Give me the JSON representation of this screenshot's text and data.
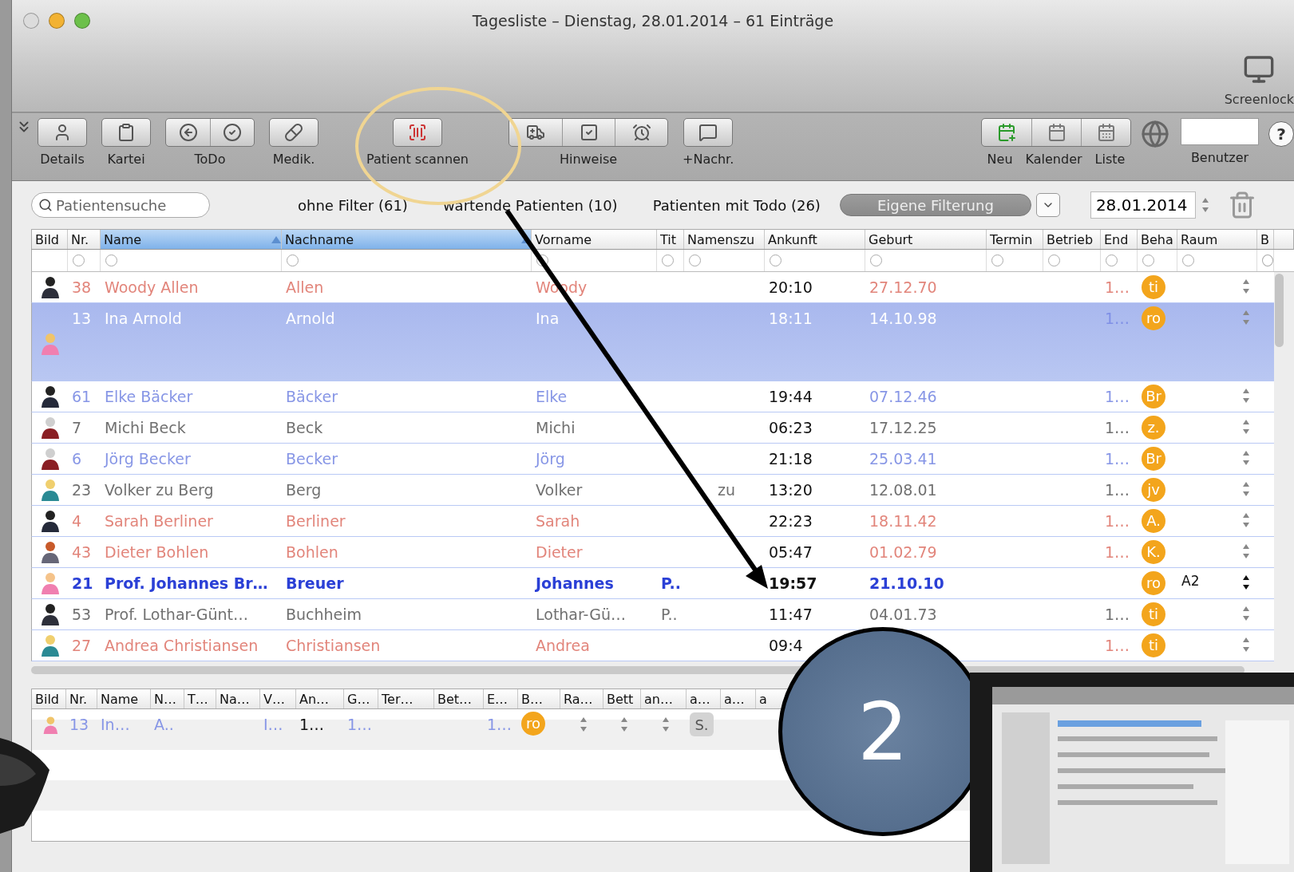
{
  "window": {
    "title": "Tagesliste – Dienstag, 28.01.2014 – 61 Einträge"
  },
  "screenlock": {
    "label": "Screenlock"
  },
  "toolbar": [
    {
      "kind": "single",
      "label": "Details"
    },
    {
      "kind": "single",
      "label": "Kartei"
    },
    {
      "kind": "double",
      "label": "ToDo"
    },
    {
      "kind": "single",
      "label": "Medik."
    },
    {
      "kind": "single",
      "label": "Patient scannen"
    },
    {
      "kind": "triple",
      "label": "Hinweise"
    },
    {
      "kind": "single",
      "label": "+Nachr."
    }
  ],
  "calendar_group": {
    "labels": [
      "Neu",
      "Kalender",
      "Liste"
    ]
  },
  "user_field": {
    "label": "Benutzer"
  },
  "help": "?",
  "filter_bar": {
    "search_placeholder": "Patientensuche",
    "filters": [
      "ohne Filter (61)",
      "wartende Patienten (10)",
      "Patienten mit Todo (26)"
    ],
    "custom_filter": "Eigene Filterung",
    "date": "28.01.2014"
  },
  "table": {
    "columns": [
      {
        "label": "Bild",
        "sorted": false
      },
      {
        "label": "Nr.",
        "sorted": false
      },
      {
        "label": "Name",
        "sorted": true
      },
      {
        "label": "Nachname",
        "sorted": true
      },
      {
        "label": "Vorname",
        "sorted": false
      },
      {
        "label": "Tit",
        "sorted": false
      },
      {
        "label": "Namenszu",
        "sorted": false
      },
      {
        "label": "Ankunft",
        "sorted": false
      },
      {
        "label": "Geburt",
        "sorted": false
      },
      {
        "label": "Termin",
        "sorted": false
      },
      {
        "label": "Betrieb",
        "sorted": false
      },
      {
        "label": "End",
        "sorted": false
      },
      {
        "label": "Beha",
        "sorted": false
      },
      {
        "label": "Raum",
        "sorted": false
      },
      {
        "label": "B",
        "sorted": false
      }
    ],
    "rows": [
      {
        "avatar": {
          "kind": "suit"
        },
        "nr": "38",
        "name": "Woody Allen",
        "nachname": "Allen",
        "vorname": "Woody",
        "ankunft": "20:10",
        "geburt": "27.12.70",
        "end": "1…",
        "beha": "ti",
        "color": "#e2857b",
        "bold": false,
        "selected": false
      },
      {
        "avatar": {
          "kind": "girl"
        },
        "nr": "13",
        "name": "Ina Arnold",
        "nachname": "Arnold",
        "vorname": "Ina",
        "ankunft": "18:11",
        "geburt": "14.10.98",
        "end": "1…",
        "beha": "ro",
        "color": "#7f8fe6",
        "bold": false,
        "selected": true
      },
      {
        "avatar": {
          "kind": "hat"
        },
        "nr": "61",
        "name": "Elke Bäcker",
        "nachname": "Bäcker",
        "vorname": "Elke",
        "ankunft": "19:44",
        "geburt": "07.12.46",
        "end": "1…",
        "beha": "Br",
        "color": "#8796e6",
        "bold": false,
        "selected": false
      },
      {
        "avatar": {
          "kind": "grandma"
        },
        "nr": "7",
        "name": "Michi Beck",
        "nachname": "Beck",
        "vorname": "Michi",
        "ankunft": "06:23",
        "geburt": "17.12.25",
        "end": "1…",
        "beha": "z.",
        "color": "#707070",
        "bold": false,
        "selected": false
      },
      {
        "avatar": {
          "kind": "grandma"
        },
        "nr": "6",
        "name": "Jörg Becker",
        "nachname": "Becker",
        "vorname": "Jörg",
        "ankunft": "21:18",
        "geburt": "25.03.41",
        "end": "1…",
        "beha": "Br",
        "color": "#8796e6",
        "bold": false,
        "selected": false
      },
      {
        "avatar": {
          "kind": "boy"
        },
        "nr": "23",
        "name": "Volker zu Berg",
        "nachname": "Berg",
        "vorname": "Volker",
        "namenszu": "zu",
        "ankunft": "13:20",
        "geburt": "12.08.01",
        "end": "1…",
        "beha": "jv",
        "color": "#707070",
        "bold": false,
        "selected": false
      },
      {
        "avatar": {
          "kind": "hat"
        },
        "nr": "4",
        "name": "Sarah Berliner",
        "nachname": "Berliner",
        "vorname": "Sarah",
        "ankunft": "22:23",
        "geburt": "18.11.42",
        "end": "1…",
        "beha": "A.",
        "color": "#e2857b",
        "bold": false,
        "selected": false
      },
      {
        "avatar": {
          "kind": "redhead"
        },
        "nr": "43",
        "name": "Dieter Bohlen",
        "nachname": "Bohlen",
        "vorname": "Dieter",
        "ankunft": "05:47",
        "geburt": "01.02.79",
        "end": "1…",
        "beha": "K.",
        "color": "#e2857b",
        "bold": false,
        "selected": false
      },
      {
        "avatar": {
          "kind": "baby"
        },
        "nr": "21",
        "name": "Prof. Johannes Br…",
        "nachname": "Breuer",
        "vorname": "Johannes",
        "tit": "P..",
        "ankunft": "19:57",
        "geburt": "21.10.10",
        "beha": "ro",
        "raum": "A2",
        "color": "#2b40d6",
        "bold": true,
        "selected": false
      },
      {
        "avatar": {
          "kind": "suit"
        },
        "nr": "53",
        "name": "Prof. Lothar-Günt…",
        "nachname": "Buchheim",
        "vorname": "Lothar-Gü…",
        "tit": "P..",
        "ankunft": "11:47",
        "geburt": "04.01.73",
        "end": "1…",
        "beha": "ti",
        "color": "#707070",
        "bold": false,
        "selected": false
      },
      {
        "avatar": {
          "kind": "boy"
        },
        "nr": "27",
        "name": "Andrea Christiansen",
        "nachname": "Christiansen",
        "vorname": "Andrea",
        "ankunft": "09:4",
        "end": "1…",
        "beha": "ti",
        "color": "#e2857b",
        "bold": false,
        "selected": false
      }
    ]
  },
  "detail_table": {
    "columns": [
      "Bild",
      "Nr.",
      "Name",
      "N…",
      "T…",
      "Na…",
      "V…",
      "An…",
      "G…",
      "Ter…",
      "Bet…",
      "E…",
      "B…",
      "Ra…",
      "Bett",
      "an…",
      "a…",
      "a…",
      "a"
    ],
    "cells": [
      {
        "kind": "avatar"
      },
      {
        "kind": "text",
        "text": "13"
      },
      {
        "kind": "text",
        "text": "In…"
      },
      {
        "kind": "text",
        "text": "A.."
      },
      {
        "kind": "empty"
      },
      {
        "kind": "empty"
      },
      {
        "kind": "text",
        "text": "I…"
      },
      {
        "kind": "dark",
        "text": "1…"
      },
      {
        "kind": "text",
        "text": "1…"
      },
      {
        "kind": "empty"
      },
      {
        "kind": "empty"
      },
      {
        "kind": "text",
        "text": "1…"
      },
      {
        "kind": "badge",
        "text": "ro"
      },
      {
        "kind": "stepper"
      },
      {
        "kind": "stepper"
      },
      {
        "kind": "stepper"
      },
      {
        "kind": "chip",
        "text": "S."
      },
      {
        "kind": "empty"
      },
      {
        "kind": "empty"
      }
    ]
  },
  "annotation": {
    "step": "2"
  }
}
